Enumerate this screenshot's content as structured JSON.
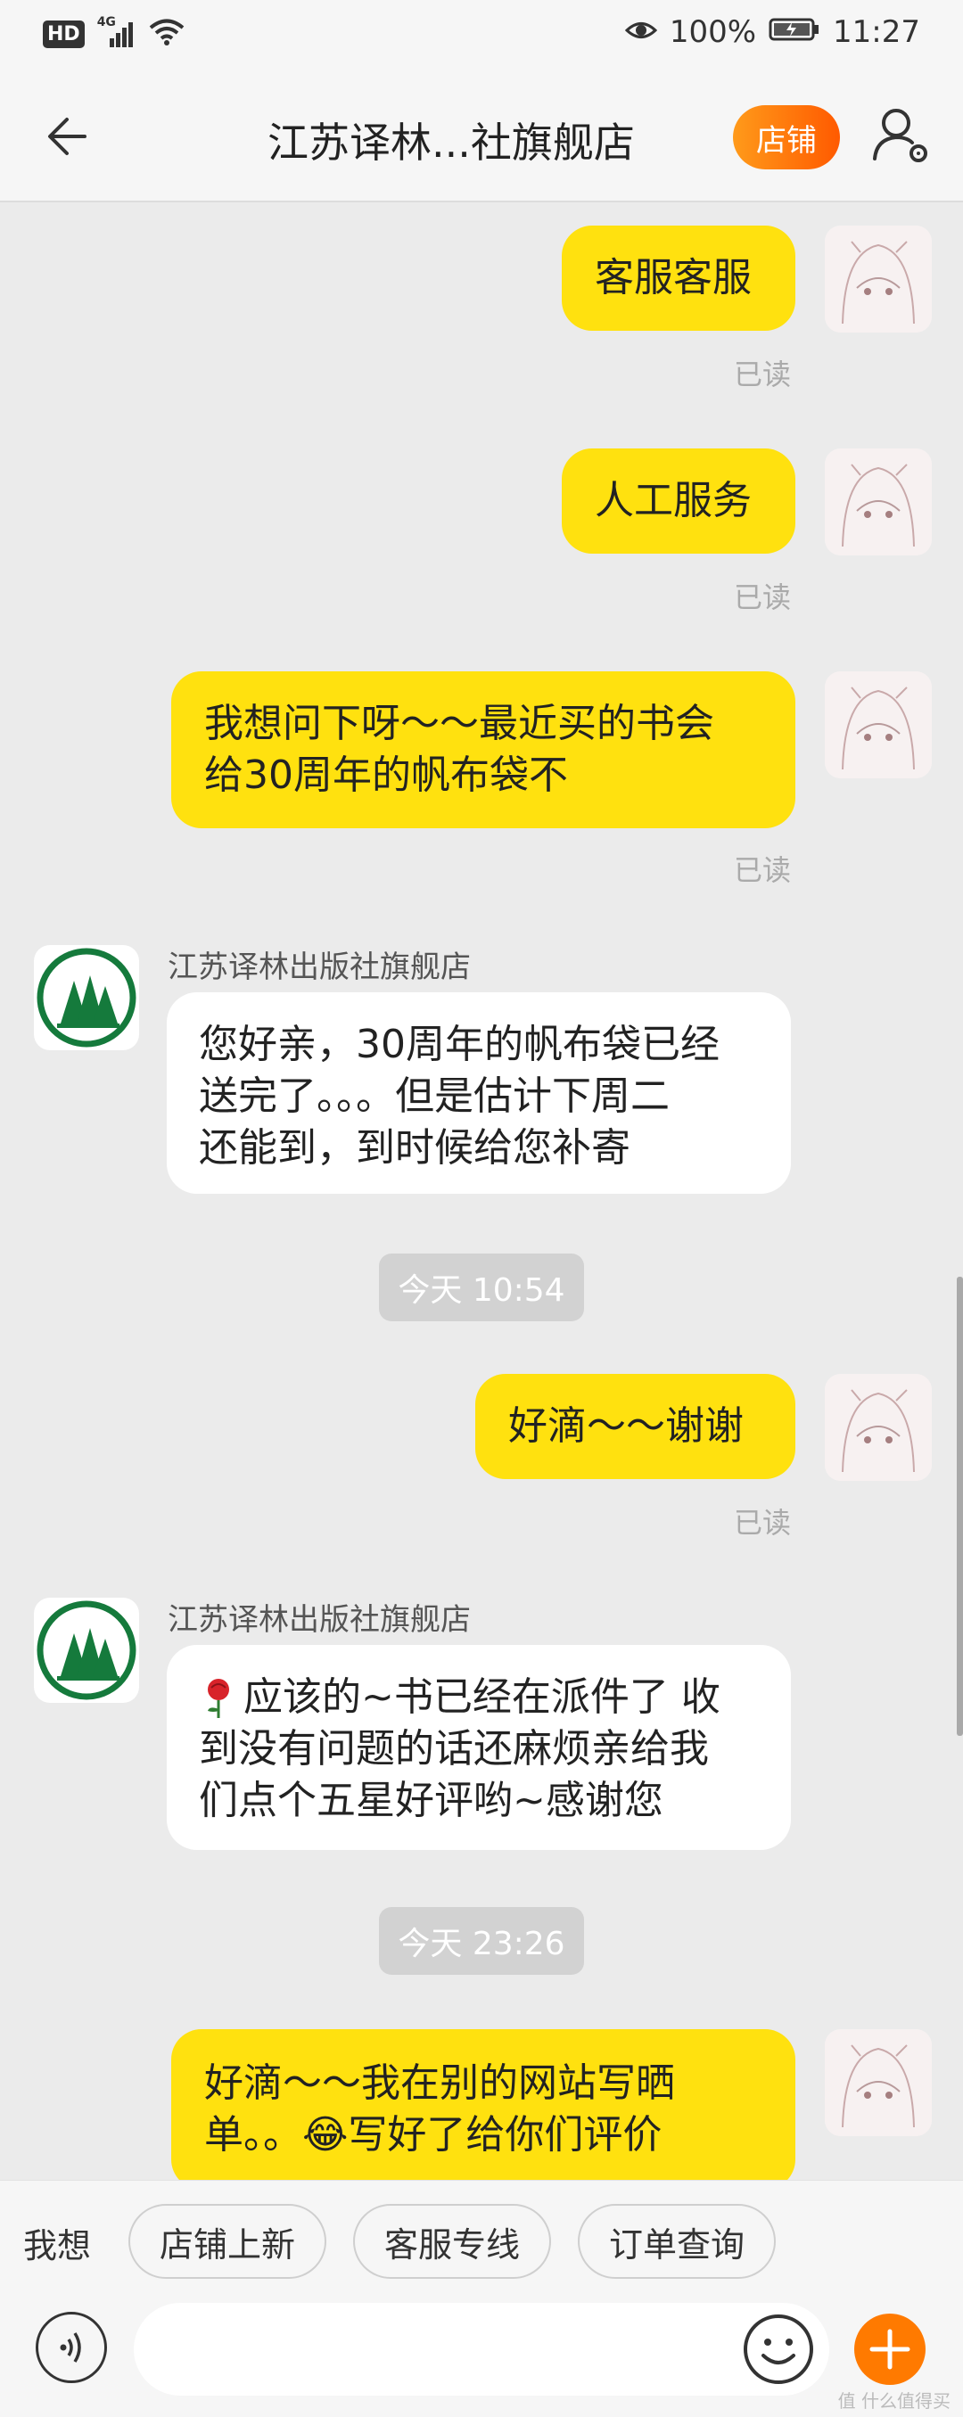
{
  "status_bar": {
    "badge": "HD",
    "network": "4G",
    "battery": "100%",
    "time": "11:27"
  },
  "header": {
    "title": "江苏译林...社旗舰店",
    "shop_button": "店铺"
  },
  "messages": [
    {
      "type": "out",
      "text": "客服客服",
      "read": "已读"
    },
    {
      "type": "out",
      "text": "人工服务",
      "read": "已读"
    },
    {
      "type": "out",
      "lines": [
        "我想问下呀～～最近买的书会",
        "给30周年的帆布袋不"
      ],
      "read": "已读"
    },
    {
      "type": "in",
      "sender": "江苏译林出版社旗舰店",
      "lines": [
        "您好亲，30周年的帆布袋已经",
        "送完了。。。但是估计下周二",
        "还能到，到时候给您补寄"
      ]
    },
    {
      "type": "time",
      "text": "今天 10:54"
    },
    {
      "type": "out",
      "text": "好滴～～谢谢",
      "read": "已读"
    },
    {
      "type": "in",
      "sender": "江苏译林出版社旗舰店",
      "lines": [
        "应该的~书已经在派件了 收",
        "到没有问题的话还麻烦亲给我",
        "们点个五星好评哟~感谢您"
      ]
    },
    {
      "type": "time",
      "text": "今天 23:26"
    },
    {
      "type": "out",
      "lines": [
        "好滴～～我在别的网站写晒",
        "单。。😂写好了给你们评价"
      ]
    }
  ],
  "quick_bar": {
    "label": "我想",
    "chips": [
      "店铺上新",
      "客服专线",
      "订单查询"
    ]
  },
  "input": {
    "placeholder": ""
  },
  "watermark": "值 什么值得买",
  "colors": {
    "outgoing_bubble": "#ffe10f",
    "accent": "#ff7a00",
    "background": "#ebebeb"
  }
}
